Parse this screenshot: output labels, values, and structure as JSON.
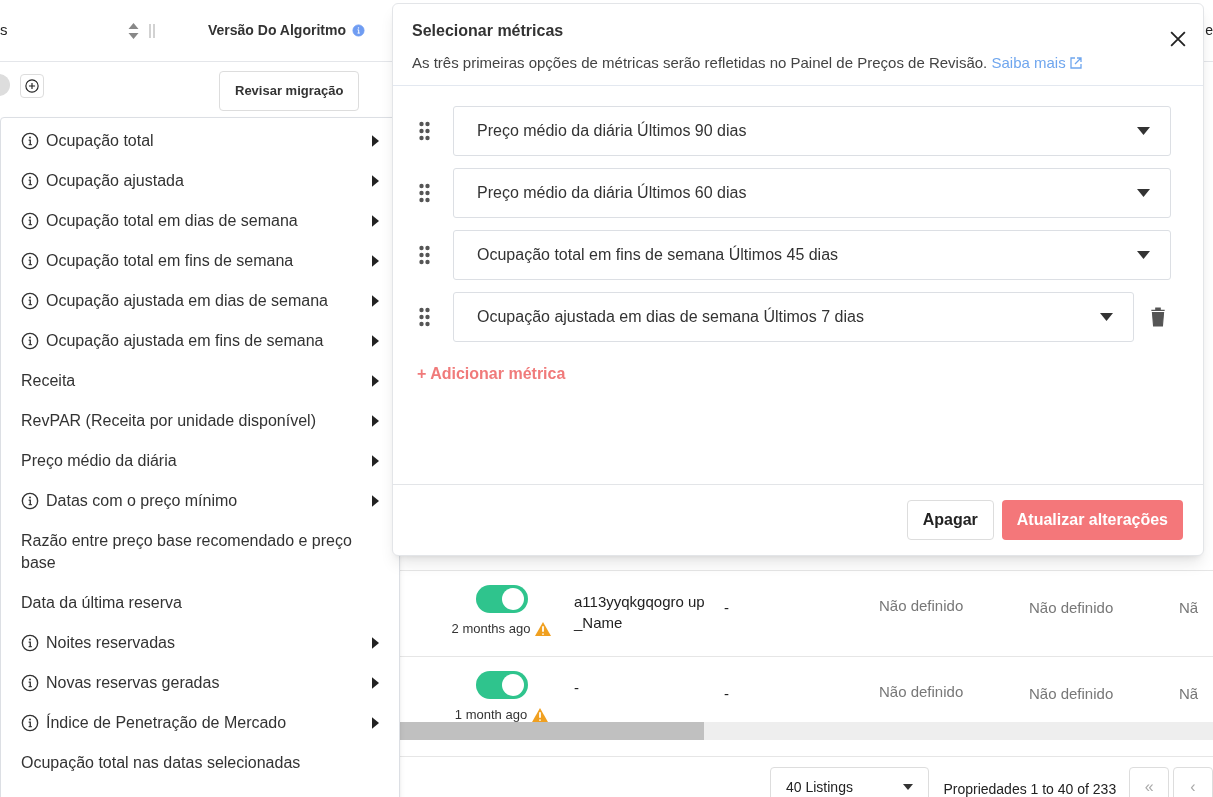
{
  "table": {
    "header": {
      "column_1": "s",
      "algorithm_version": "Versão Do Algoritmo",
      "column_3": "e"
    },
    "review_button": "Revisar migração",
    "rows": [
      {
        "enabled": true,
        "time": "2 months ago",
        "warning": true,
        "name": "a113yyqkgqogro up_Name",
        "column_2": "-",
        "column_3": "Não definido",
        "column_4": "Não definido",
        "column_5": "Nã"
      },
      {
        "enabled": true,
        "time": "1 month ago",
        "warning": true,
        "name": "-",
        "column_2": "-",
        "column_3": "Não definido",
        "column_4": "Não definido",
        "column_5": "Nã"
      }
    ]
  },
  "footer": {
    "page_size": "40 Listings",
    "range": "Propriedades 1 to 40 of 233",
    "first_page": "«",
    "prev_page": "‹"
  },
  "menu": {
    "items": [
      {
        "label": "Ocupação total",
        "info": true,
        "submenu": true
      },
      {
        "label": "Ocupação ajustada",
        "info": true,
        "submenu": true
      },
      {
        "label": "Ocupação total em dias de semana",
        "info": true,
        "submenu": true
      },
      {
        "label": "Ocupação total em fins de semana",
        "info": true,
        "submenu": true
      },
      {
        "label": "Ocupação ajustada em dias de semana",
        "info": true,
        "submenu": true
      },
      {
        "label": "Ocupação ajustada em fins de semana",
        "info": true,
        "submenu": true
      },
      {
        "label": "Receita",
        "info": false,
        "submenu": true
      },
      {
        "label": "RevPAR (Receita por unidade disponível)",
        "info": false,
        "submenu": true
      },
      {
        "label": "Preço médio da diária",
        "info": false,
        "submenu": true
      },
      {
        "label": "Datas com o preço mínimo",
        "info": true,
        "submenu": true
      },
      {
        "label": "Razão entre preço base recomendado e preço base",
        "info": false,
        "submenu": false
      },
      {
        "label": "Data da última reserva",
        "info": false,
        "submenu": false
      },
      {
        "label": "Noites reservadas",
        "info": true,
        "submenu": true
      },
      {
        "label": "Novas reservas geradas",
        "info": true,
        "submenu": true
      },
      {
        "label": "Índice de Penetração de Mercado",
        "info": true,
        "submenu": true
      },
      {
        "label": "Ocupação total nas datas selecionadas",
        "info": false,
        "submenu": false
      }
    ]
  },
  "dialog": {
    "title": "Selecionar métricas",
    "description": "As três primeiras opções de métricas serão refletidas no Painel de Preços de Revisão.",
    "link": "Saiba mais",
    "metrics": [
      {
        "value": "Preço médio da diária Últimos 90 dias",
        "removable": false
      },
      {
        "value": "Preço médio da diária Últimos 60 dias",
        "removable": false
      },
      {
        "value": "Ocupação total em fins de semana Últimos 45 dias",
        "removable": false
      },
      {
        "value": "Ocupação ajustada em dias de semana Últimos 7 dias",
        "removable": true
      }
    ],
    "add": "+ Adicionar métrica",
    "cancel": "Apagar",
    "submit": "Atualizar alterações"
  }
}
